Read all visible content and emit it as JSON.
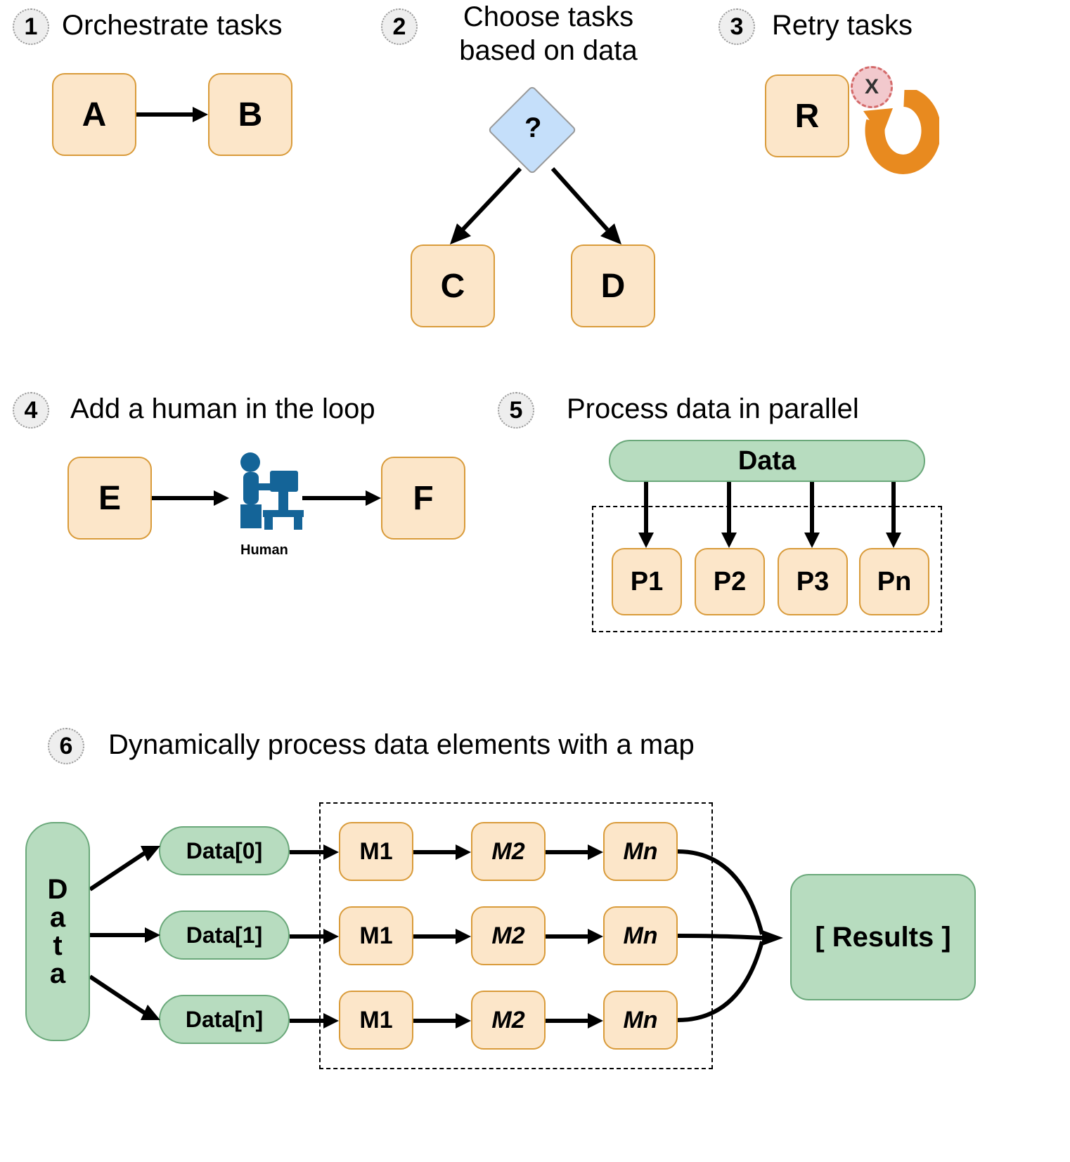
{
  "sections": {
    "s1": {
      "num": "1",
      "title": "Orchestrate tasks",
      "a": "A",
      "b": "B"
    },
    "s2": {
      "num": "2",
      "title": "Choose tasks based on data",
      "q": "?",
      "c": "C",
      "d": "D"
    },
    "s3": {
      "num": "3",
      "title": "Retry tasks",
      "r": "R",
      "x": "X"
    },
    "s4": {
      "num": "4",
      "title": "Add a human in the loop",
      "e": "E",
      "f": "F",
      "human": "Human"
    },
    "s5": {
      "num": "5",
      "title": "Process data in parallel",
      "data": "Data",
      "p": [
        "P1",
        "P2",
        "P3",
        "Pn"
      ]
    },
    "s6": {
      "num": "6",
      "title": "Dynamically process data elements with a map",
      "data": "Data",
      "rows": [
        "Data[0]",
        "Data[1]",
        "Data[n]"
      ],
      "m": [
        "M1",
        "M2",
        "Mn"
      ],
      "results": "[ Results ]"
    }
  }
}
